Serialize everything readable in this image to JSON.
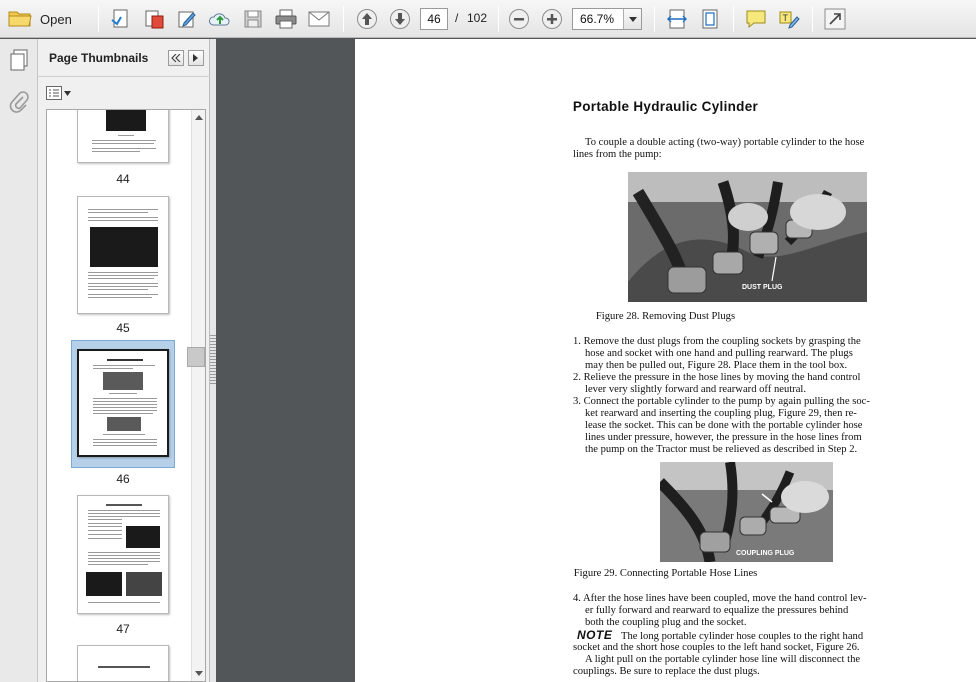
{
  "toolbar": {
    "open_label": "Open",
    "current_page": "46",
    "page_separator": "/",
    "total_pages": "102",
    "zoom": "66.7%"
  },
  "panel": {
    "title": "Page Thumbnails",
    "thumbnails": [
      {
        "label": "44"
      },
      {
        "label": "45"
      },
      {
        "label": "46"
      },
      {
        "label": "47"
      }
    ]
  },
  "document": {
    "title": "Portable Hydraulic Cylinder",
    "intro": [
      "To couple a double acting (two-way) portable cylinder to the hose",
      "lines from the pump:"
    ],
    "figure1": {
      "label": "DUST PLUG",
      "caption": "Figure 28. Removing Dust Plugs"
    },
    "steps": [
      "1. Remove the dust plugs from the coupling sockets by grasping the",
      "hose and socket with one hand and pulling rearward. The plugs",
      "may then be pulled out, Figure 28. Place them in the tool box.",
      "2. Relieve the pressure in the hose lines by moving the hand control",
      "lever very slightly forward and rearward off neutral.",
      "3. Connect the portable cylinder to the pump by again pulling the soc-",
      "ket rearward and inserting the coupling plug, Figure 29, then re-",
      "lease the socket. This can be done with the portable cylinder hose",
      "lines under pressure, however, the pressure in the hose lines from",
      "the pump on the Tractor must be relieved as described in Step 2."
    ],
    "figure2": {
      "label": "COUPLING PLUG",
      "caption": "Figure 29. Connecting Portable Hose Lines"
    },
    "step4": [
      "4. After the hose lines have been coupled, move the hand control lev-",
      "er fully forward and rearward to equalize the pressures behind",
      "both the coupling plug and the socket."
    ],
    "note_word": "NOTE",
    "note": [
      "The long portable cylinder hose couples to the right hand",
      "socket and the short hose couples to the left hand socket, Figure 26.",
      "A light pull on the portable cylinder hose line will disconnect the",
      "couplings. Be sure to replace the dust plugs."
    ]
  },
  "colors": {
    "doc_background": "#525659",
    "selection": "#b7d0ea",
    "toolbar": "#eeeeee"
  }
}
